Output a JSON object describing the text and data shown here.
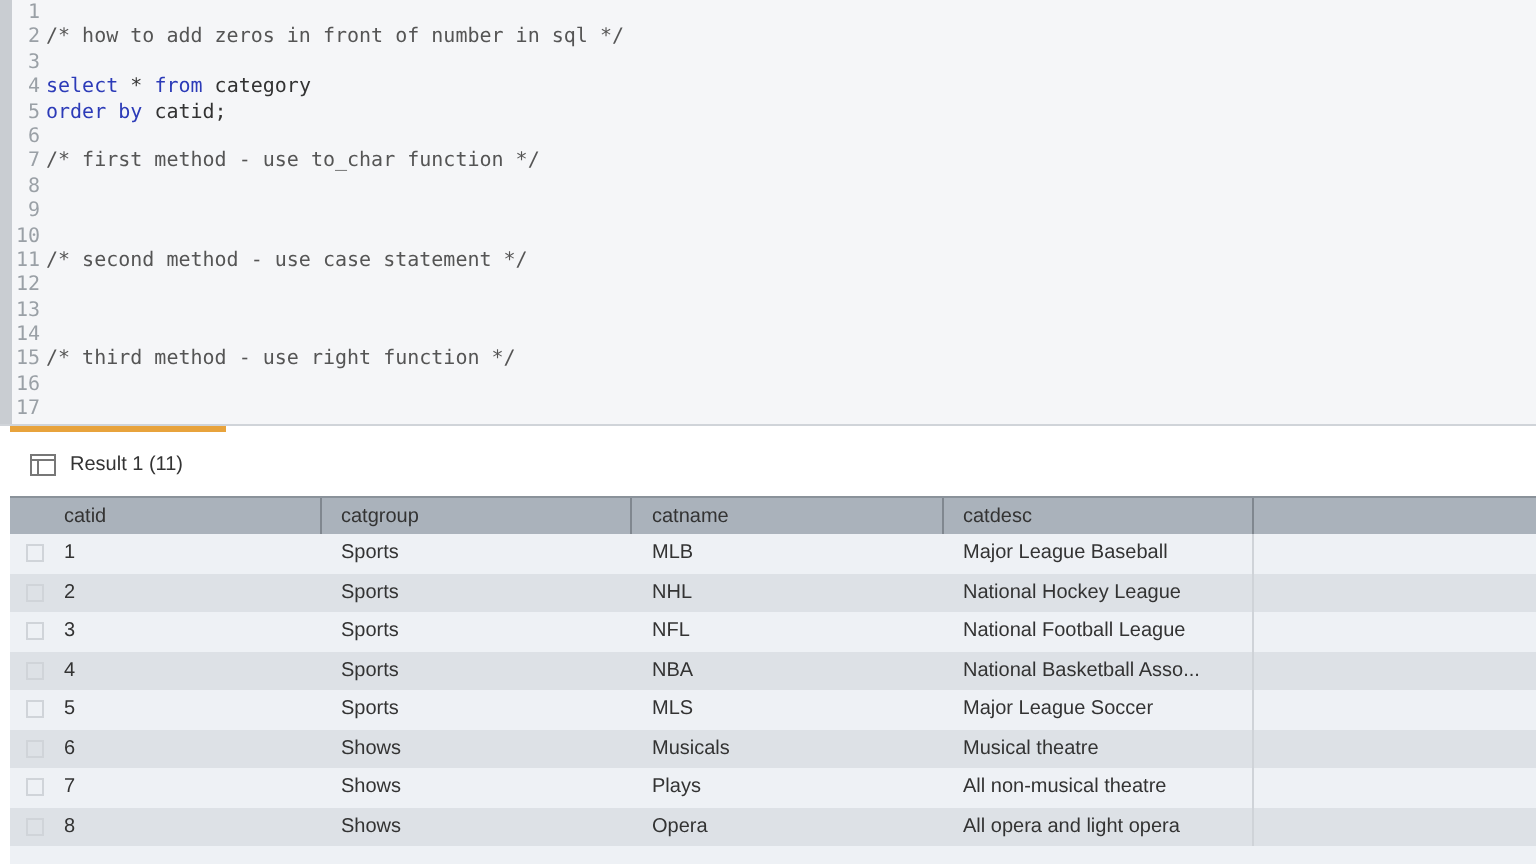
{
  "editor": {
    "lines": [
      {
        "number": "1"
      },
      {
        "number": "2",
        "tokens": [
          {
            "text": "/* how to add zeros in front of number in sql */",
            "kind": "comment"
          }
        ]
      },
      {
        "number": "3"
      },
      {
        "number": "4",
        "tokens": [
          {
            "text": "select",
            "kind": "keyword"
          },
          {
            "text": " * ",
            "kind": "plain"
          },
          {
            "text": "from",
            "kind": "keyword"
          },
          {
            "text": " category",
            "kind": "plain"
          }
        ]
      },
      {
        "number": "5",
        "tokens": [
          {
            "text": "order by",
            "kind": "keyword"
          },
          {
            "text": " catid;",
            "kind": "plain"
          }
        ]
      },
      {
        "number": "6"
      },
      {
        "number": "7",
        "tokens": [
          {
            "text": "/* first method - use to_char function */",
            "kind": "comment"
          }
        ]
      },
      {
        "number": "8"
      },
      {
        "number": "9"
      },
      {
        "number": "10"
      },
      {
        "number": "11",
        "tokens": [
          {
            "text": "/* second method - use case statement */",
            "kind": "comment"
          }
        ]
      },
      {
        "number": "12"
      },
      {
        "number": "13"
      },
      {
        "number": "14"
      },
      {
        "number": "15",
        "tokens": [
          {
            "text": "/* third method - use right function */",
            "kind": "comment"
          }
        ]
      },
      {
        "number": "16"
      },
      {
        "number": "17"
      }
    ]
  },
  "results": {
    "tabs": [
      {
        "label": "Result 1 (11)",
        "selected": true
      }
    ],
    "columns": [
      "catid",
      "catgroup",
      "catname",
      "catdesc"
    ],
    "rows": [
      {
        "checked": false,
        "cells": [
          "1",
          "Sports",
          "MLB",
          "Major League Baseball"
        ]
      },
      {
        "checked": false,
        "cells": [
          "2",
          "Sports",
          "NHL",
          "National Hockey League"
        ]
      },
      {
        "checked": false,
        "cells": [
          "3",
          "Sports",
          "NFL",
          "National Football League"
        ]
      },
      {
        "checked": false,
        "cells": [
          "4",
          "Sports",
          "NBA",
          "National Basketball Asso..."
        ]
      },
      {
        "checked": false,
        "cells": [
          "5",
          "Sports",
          "MLS",
          "Major League Soccer"
        ]
      },
      {
        "checked": false,
        "cells": [
          "6",
          "Shows",
          "Musicals",
          "Musical theatre"
        ]
      },
      {
        "checked": false,
        "cells": [
          "7",
          "Shows",
          "Plays",
          "All non-musical theatre"
        ]
      },
      {
        "checked": false,
        "cells": [
          "8",
          "Shows",
          "Opera",
          "All opera and light opera"
        ]
      }
    ]
  }
}
